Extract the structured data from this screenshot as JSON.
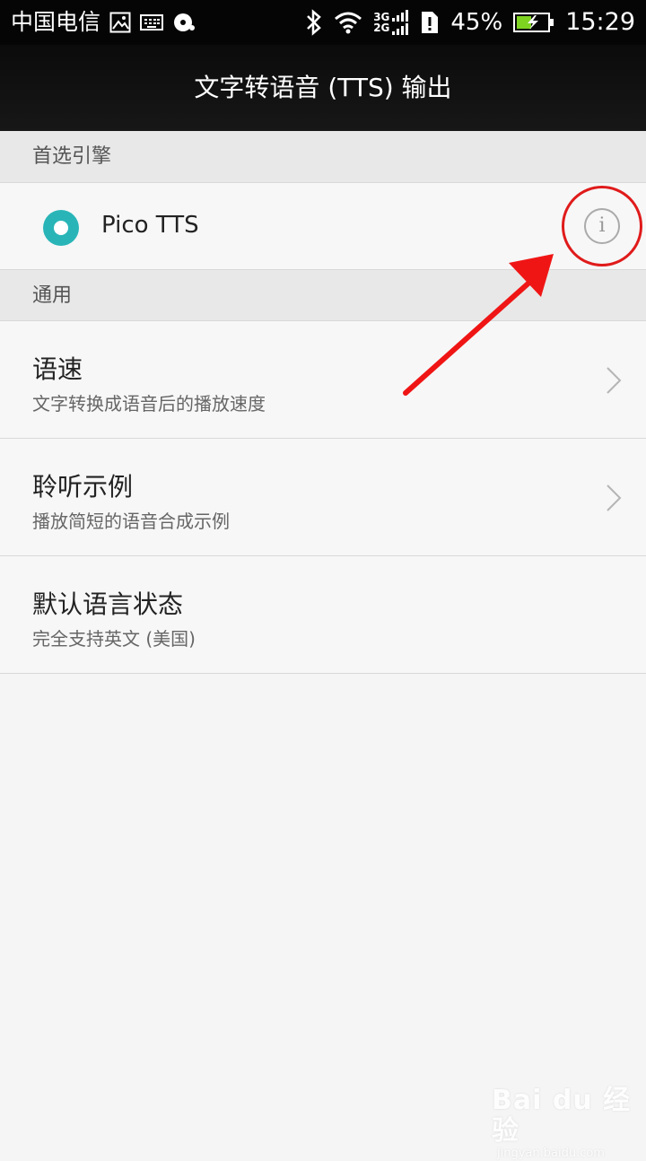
{
  "status_bar": {
    "carrier": "中国电信",
    "net_top": "3G",
    "net_bottom": "2G",
    "battery": "45%",
    "time": "15:29",
    "icons": [
      "gallery-icon",
      "keyboard-icon",
      "disc-icon",
      "bluetooth-icon",
      "wifi-icon",
      "signal-icon",
      "sim-alert-icon",
      "battery-charging-icon"
    ]
  },
  "app_bar": {
    "title": "文字转语音 (TTS) 输出"
  },
  "preferred_engine": {
    "header": "首选引擎",
    "engine_label": "Pico TTS",
    "selected": true,
    "info_glyph": "i"
  },
  "general": {
    "header": "通用",
    "items": [
      {
        "title": "语速",
        "subtitle": "文字转换成语音后的播放速度",
        "has_chevron": true
      },
      {
        "title": "聆听示例",
        "subtitle": "播放简短的语音合成示例",
        "has_chevron": true
      },
      {
        "title": "默认语言状态",
        "subtitle": "完全支持英文 (美国)",
        "has_chevron": false
      }
    ]
  },
  "colors": {
    "accent": "#29b5b8",
    "annotation": "#e01b1b",
    "background": "#f5f5f5",
    "section_header": "#e8e8e8"
  },
  "watermark": {
    "logo": "Bai du 经验",
    "url": "jingyan.baidu.com"
  }
}
